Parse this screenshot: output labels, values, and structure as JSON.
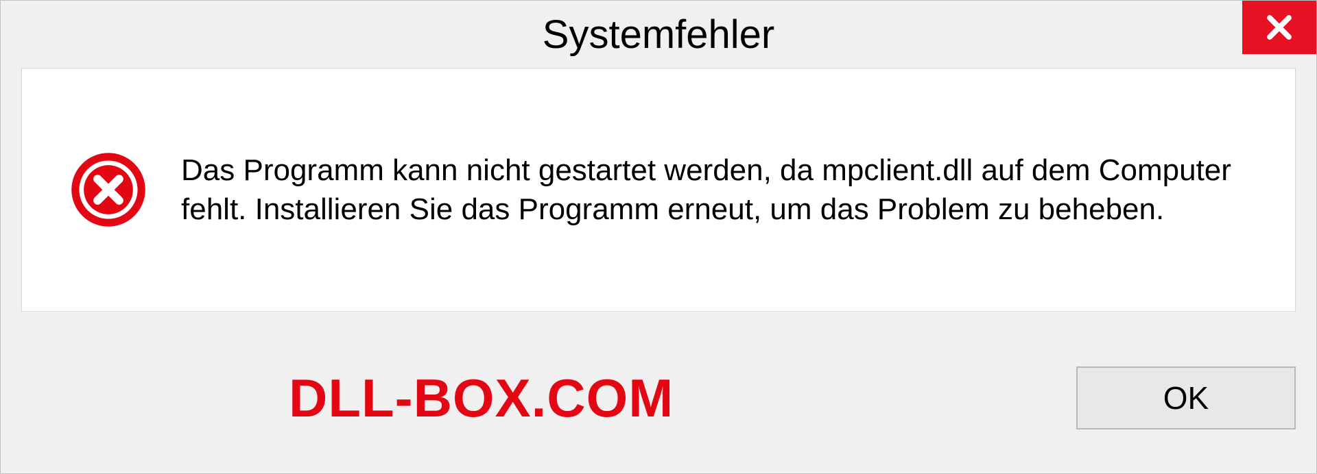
{
  "title": "Systemfehler",
  "message": "Das Programm kann nicht gestartet werden, da mpclient.dll auf dem Computer fehlt. Installieren Sie das Programm erneut, um das Problem zu beheben.",
  "watermark": "DLL-BOX.COM",
  "ok_label": "OK"
}
